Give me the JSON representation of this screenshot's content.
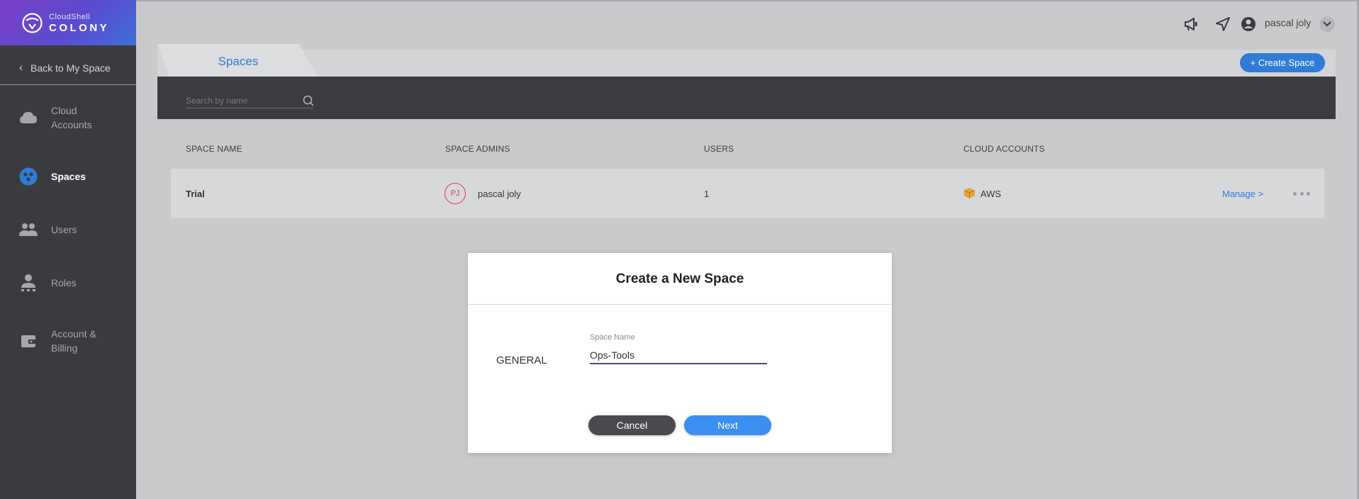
{
  "brand": {
    "small": "CloudShell",
    "big": "COLONY"
  },
  "sidebar": {
    "back_label": "Back to My Space",
    "items": [
      {
        "label": "Cloud Accounts",
        "icon": "cloud-icon"
      },
      {
        "label": "Spaces",
        "icon": "spaces-icon",
        "active": true
      },
      {
        "label": "Users",
        "icon": "users-icon"
      },
      {
        "label": "Roles",
        "icon": "roles-icon"
      },
      {
        "label": "Account & Billing",
        "icon": "billing-icon"
      }
    ]
  },
  "topbar": {
    "user_name": "pascal joly",
    "icons": [
      "megaphone-icon",
      "send-icon",
      "user-circle-icon",
      "chevron-down-icon"
    ]
  },
  "header": {
    "tab_label": "Spaces",
    "create_button": "+ Create Space",
    "search_placeholder": "Search by name"
  },
  "table": {
    "columns": [
      "SPACE NAME",
      "SPACE ADMINS",
      "USERS",
      "CLOUD ACCOUNTS"
    ],
    "rows": [
      {
        "name": "Trial",
        "admin_initials": "PJ",
        "admin_name": "pascal joly",
        "users": "1",
        "cloud": "AWS",
        "manage": "Manage >"
      }
    ]
  },
  "modal": {
    "title": "Create a New Space",
    "section": "GENERAL",
    "field_label": "Space Name",
    "field_value": "Ops-Tools",
    "cancel": "Cancel",
    "next": "Next"
  },
  "colors": {
    "accent": "#2f7cd6",
    "sidebar": "#3a3b3f",
    "avatar": "#d4424a",
    "next": "#3b8ff0"
  }
}
